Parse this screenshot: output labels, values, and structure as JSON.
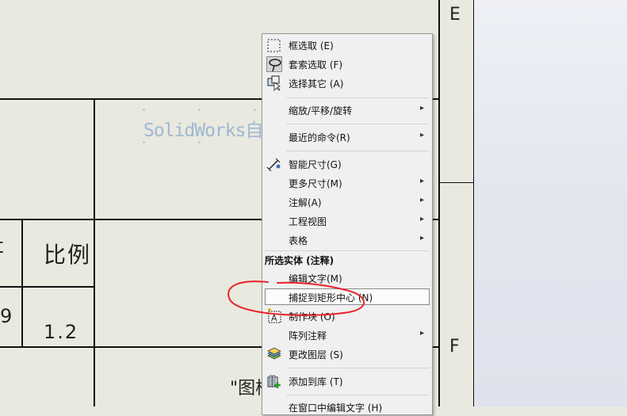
{
  "drawing": {
    "zone_labels": {
      "top_right": "E",
      "bottom_right": "F"
    },
    "annotation_text": "SolidWorks自学",
    "title_block": {
      "scale_label": "比例",
      "scale_value": "1.2",
      "partial_left_char": "t",
      "partial_left_num": "9",
      "bottom_text": "\"图样"
    }
  },
  "context_menu": {
    "items": [
      {
        "label": "框选取 (E)",
        "icon": "box-select-icon"
      },
      {
        "label": "套索选取 (F)",
        "icon": "lasso-select-icon"
      },
      {
        "label": "选择其它 (A)",
        "icon": "select-other-icon"
      },
      {
        "label": "缩放/平移/旋转",
        "submenu": true
      },
      {
        "label": "最近的命令(R)",
        "submenu": true
      },
      {
        "label": "智能尺寸(G)",
        "icon": "smart-dimension-icon"
      },
      {
        "label": "更多尺寸(M)",
        "submenu": true
      },
      {
        "label": "注解(A)",
        "submenu": true
      },
      {
        "label": "工程视图",
        "submenu": true
      },
      {
        "label": "表格",
        "submenu": true
      },
      {
        "label": "编辑文字(M)"
      },
      {
        "label": "捕捉到矩形中心 (N)"
      },
      {
        "label": "制作块 (O)",
        "icon": "make-block-icon"
      },
      {
        "label": "阵列注释",
        "submenu": true
      },
      {
        "label": "更改图层 (S)",
        "icon": "change-layer-icon"
      },
      {
        "label": "添加到库 (T)",
        "icon": "add-to-library-icon"
      },
      {
        "label": "在窗口中编辑文字 (H)"
      }
    ],
    "section_header": "所选实体 (注释)",
    "submenu_arrow": "▸"
  },
  "colors": {
    "sheet": "#e9e9df",
    "annotation": "#9fb8d4",
    "red_markup": "#e8222a"
  }
}
